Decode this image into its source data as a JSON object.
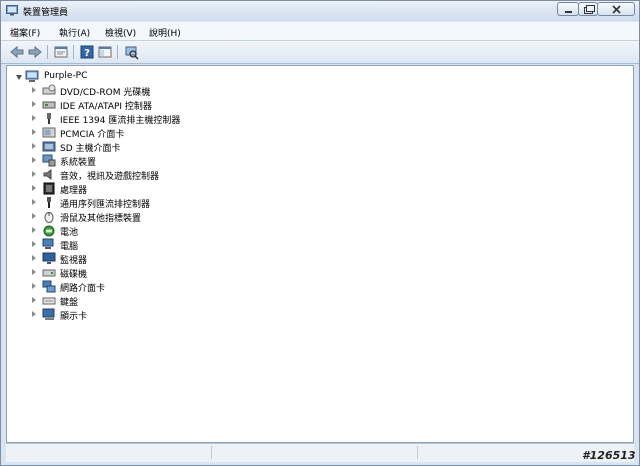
{
  "window": {
    "title": "裝置管理員",
    "title_icon": "device-manager-icon"
  },
  "controls": {
    "minimize": "minimize-icon",
    "maximize": "maximize-icon",
    "close": "close-icon"
  },
  "menu": [
    {
      "label": "檔案(F)"
    },
    {
      "label": "執行(A)"
    },
    {
      "label": "檢視(V)"
    },
    {
      "label": "說明(H)"
    }
  ],
  "toolbar": [
    "back-icon",
    "forward-icon",
    "properties-icon",
    "help-icon",
    "console-tree-icon",
    "scan-hardware-icon"
  ],
  "tree": {
    "root": {
      "label": "Purple-PC",
      "icon": "computer-icon"
    },
    "items": [
      {
        "label": "DVD/CD-ROM 光碟機",
        "icon": "dvd-drive-icon"
      },
      {
        "label": "IDE ATA/ATAPI 控制器",
        "icon": "ide-controller-icon"
      },
      {
        "label": "IEEE 1394 匯流排主機控制器",
        "icon": "ieee1394-icon"
      },
      {
        "label": "PCMCIA 介面卡",
        "icon": "pcmcia-icon"
      },
      {
        "label": "SD 主機介面卡",
        "icon": "sd-host-icon"
      },
      {
        "label": "系統裝置",
        "icon": "system-device-icon"
      },
      {
        "label": "音效，視訊及遊戲控制器",
        "icon": "speaker-icon"
      },
      {
        "label": "處理器",
        "icon": "processor-icon"
      },
      {
        "label": "通用序列匯流排控制器",
        "icon": "usb-icon"
      },
      {
        "label": "滑鼠及其他指標裝置",
        "icon": "mouse-icon"
      },
      {
        "label": "電池",
        "icon": "battery-icon"
      },
      {
        "label": "電腦",
        "icon": "computer-icon"
      },
      {
        "label": "監視器",
        "icon": "monitor-icon"
      },
      {
        "label": "磁碟機",
        "icon": "disk-drive-icon"
      },
      {
        "label": "網路介面卡",
        "icon": "network-adapter-icon"
      },
      {
        "label": "鍵盤",
        "icon": "keyboard-icon"
      },
      {
        "label": "顯示卡",
        "icon": "display-adapter-icon"
      }
    ]
  },
  "watermark": "#126513",
  "colors": {
    "titlebar": "#d8e4f1",
    "content_bg": "#ffffff",
    "border": "#8ea2b8"
  }
}
